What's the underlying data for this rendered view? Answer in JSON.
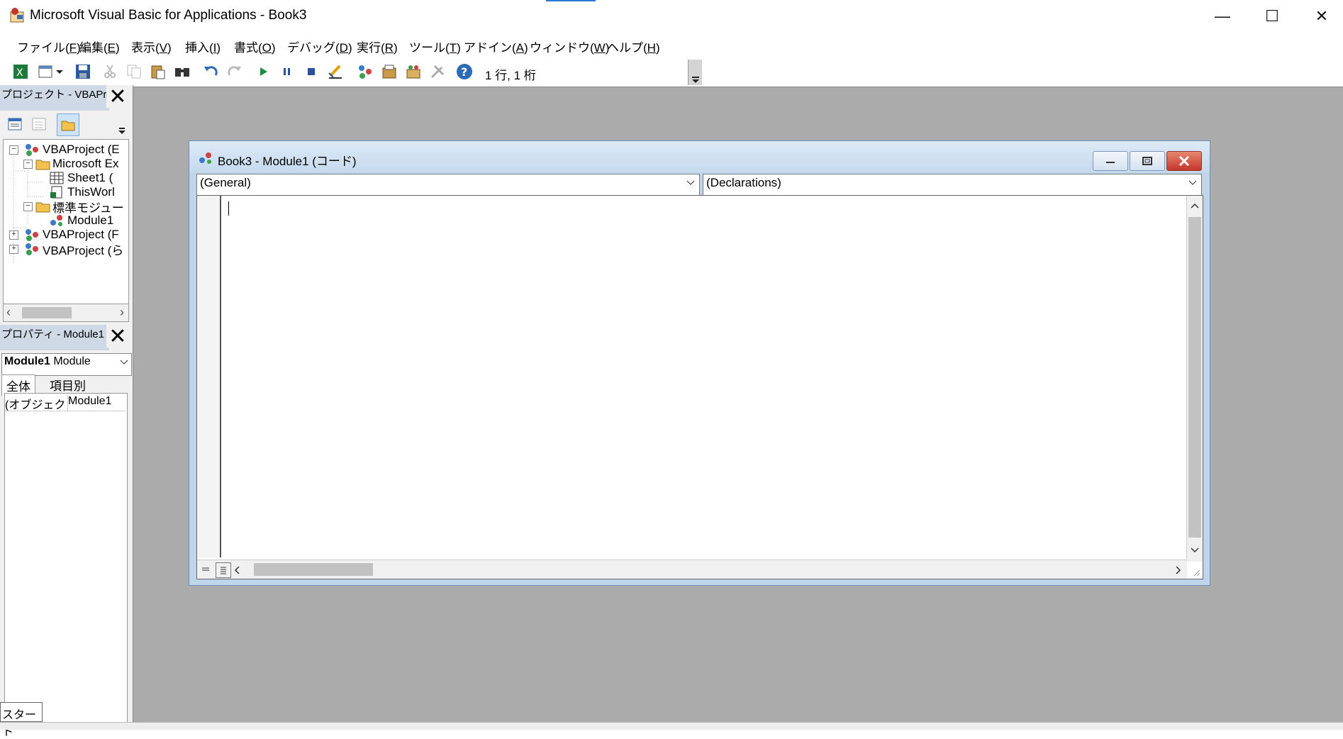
{
  "window": {
    "title": "Microsoft Visual Basic for Applications - Book3",
    "minimize_glyph": "—",
    "maximize_glyph": "☐",
    "close_glyph": "✕"
  },
  "menu": [
    {
      "label": "ファイル(",
      "key": "F",
      "end": ")"
    },
    {
      "label": "編集(",
      "key": "E",
      "end": ")"
    },
    {
      "label": "表示(",
      "key": "V",
      "end": ")"
    },
    {
      "label": "挿入(",
      "key": "I",
      "end": ")"
    },
    {
      "label": "書式(",
      "key": "O",
      "end": ")"
    },
    {
      "label": "デバッグ(",
      "key": "D",
      "end": ")"
    },
    {
      "label": "実行(",
      "key": "R",
      "end": ")"
    },
    {
      "label": "ツール(",
      "key": "T",
      "end": ")"
    },
    {
      "label": "アドイン(",
      "key": "A",
      "end": ")"
    },
    {
      "label": "ウィンドウ(",
      "key": "W",
      "end": ")"
    },
    {
      "label": "ヘルプ(",
      "key": "H",
      "end": ")"
    }
  ],
  "toolbar": {
    "cursor_position": "1 行, 1 桁",
    "icons": [
      "excel-icon",
      "insert-userform-icon",
      "save-icon",
      "cut-icon",
      "copy-icon",
      "paste-icon",
      "find-icon",
      "undo-icon",
      "redo-icon",
      "run-icon",
      "break-icon",
      "reset-icon",
      "design-mode-icon",
      "project-explorer-icon",
      "properties-window-icon",
      "object-browser-icon",
      "toolbox-icon",
      "help-icon"
    ]
  },
  "project_panel": {
    "title": "プロジェクト - VBAProje",
    "tree": [
      {
        "label": "VBAProject (E",
        "level": 0,
        "expander": "−"
      },
      {
        "label": "Microsoft Ex",
        "level": 1,
        "expander": "−"
      },
      {
        "label": "Sheet1 (",
        "level": 2,
        "expander": ""
      },
      {
        "label": "ThisWorl",
        "level": 2,
        "expander": ""
      },
      {
        "label": "標準モジュー",
        "level": 1,
        "expander": "−"
      },
      {
        "label": "Module1",
        "level": 2,
        "expander": ""
      },
      {
        "label": "VBAProject (F",
        "level": 0,
        "expander": "+"
      },
      {
        "label": "VBAProject (ら",
        "level": 0,
        "expander": "+"
      }
    ]
  },
  "properties_panel": {
    "title": "プロパティ - Module1",
    "object_name": "Module1",
    "object_type": "Module",
    "tabs": [
      "全体",
      "項目別"
    ],
    "row_name": "(オブジェクト名)",
    "row_value": "Module1"
  },
  "start_tooltip": "スタート",
  "code_window": {
    "title": "Book3 - Module1 (コード)",
    "object_combo": "(General)",
    "procedure_combo": "(Declarations)"
  }
}
